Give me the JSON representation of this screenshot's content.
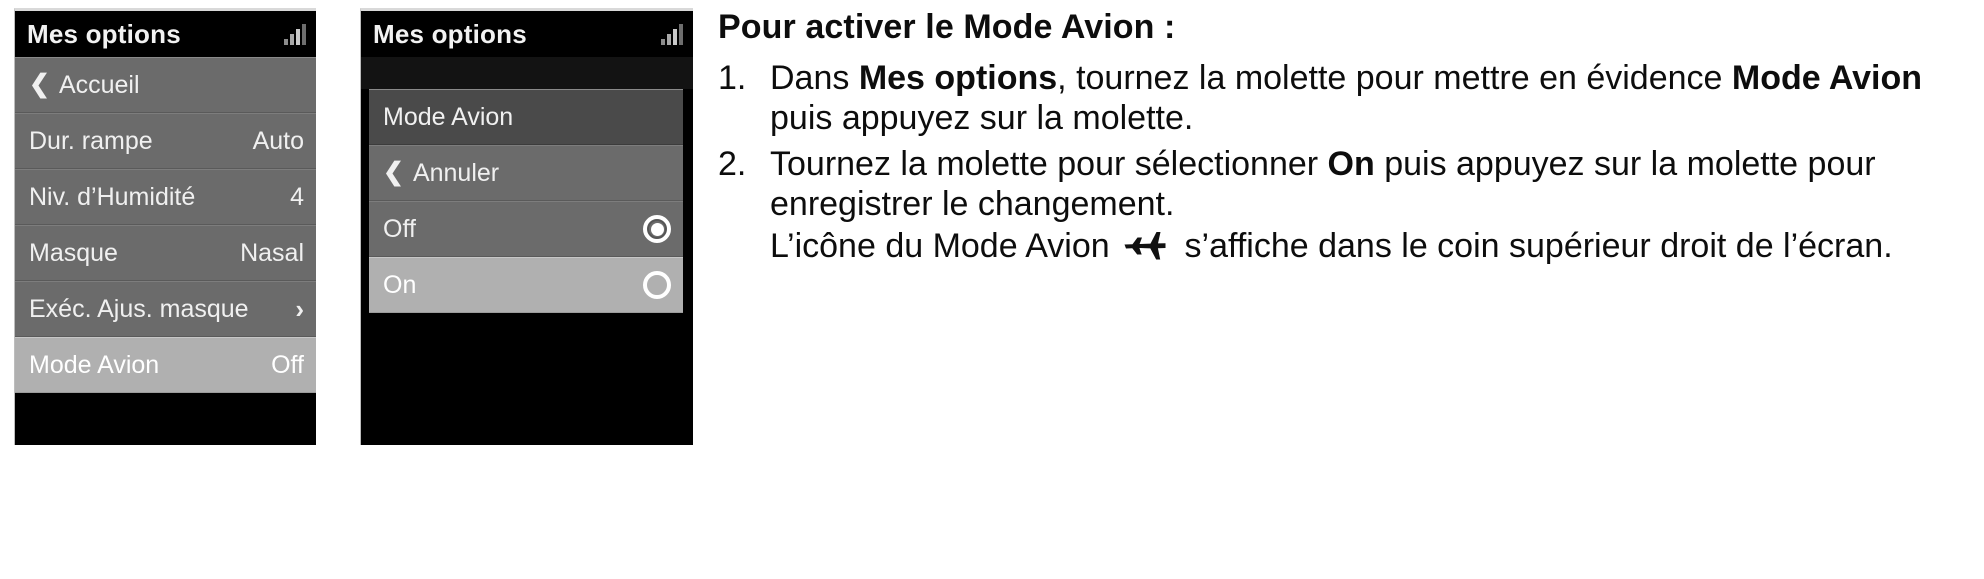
{
  "screen1": {
    "title": "Mes options",
    "status_icon": "signal-bars-icon",
    "rows": [
      {
        "label": "Accueil",
        "value": "",
        "type": "back"
      },
      {
        "label": "Dur. rampe",
        "value": "Auto",
        "type": "value"
      },
      {
        "label": "Niv. d’Humidité",
        "value": "4",
        "type": "value"
      },
      {
        "label": "Masque",
        "value": "Nasal",
        "type": "value"
      },
      {
        "label": "Exéc. Ajus. masque",
        "value": "›",
        "type": "submenu"
      },
      {
        "label": "Mode Avion",
        "value": "Off",
        "type": "selected"
      }
    ]
  },
  "screen2": {
    "title": "Mes options",
    "status_icon": "signal-bars-icon",
    "menu_title": "Mode Avion",
    "cancel_label": "Annuler",
    "options": [
      {
        "label": "Off",
        "selected_radio": true,
        "highlighted": false
      },
      {
        "label": "On",
        "selected_radio": false,
        "highlighted": true
      }
    ]
  },
  "instructions": {
    "heading": "Pour activer le Mode Avion :",
    "steps": [
      {
        "number": "1.",
        "parts": [
          {
            "text": "Dans ",
            "bold": false
          },
          {
            "text": "Mes options",
            "bold": true
          },
          {
            "text": ", tournez la molette pour mettre en évidence ",
            "bold": false
          },
          {
            "text": "Mode Avion",
            "bold": true
          },
          {
            "text": " puis appuyez sur la molette.",
            "bold": false
          }
        ]
      },
      {
        "number": "2.",
        "parts": [
          {
            "text": "Tournez la molette pour sélectionner ",
            "bold": false
          },
          {
            "text": "On",
            "bold": true
          },
          {
            "text": " puis appuyez sur la molette pour enregistrer le changement.",
            "bold": false
          }
        ],
        "sub_parts": [
          {
            "text": "L’icône du Mode Avion ",
            "bold": false,
            "icon": null
          },
          {
            "text": "",
            "bold": false,
            "icon": "airplane-icon"
          },
          {
            "text": " s’affiche dans le coin supérieur droit de l’écran.",
            "bold": false,
            "icon": null
          }
        ]
      }
    ]
  },
  "colors": {
    "lcd_background": "#000000",
    "lcd_row": "#6b6b6b",
    "lcd_row_selected": "#b0b0b0",
    "lcd_title_row": "#4a4a4a",
    "text_light": "#f0f0f0",
    "page_text": "#0d0d0d"
  }
}
